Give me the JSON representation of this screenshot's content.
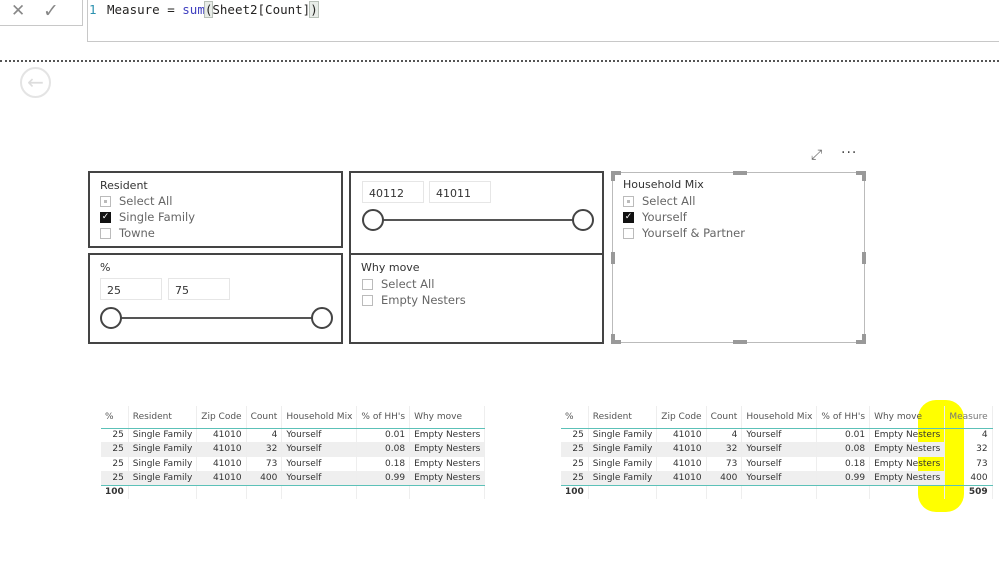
{
  "formula_bar": {
    "line_number": "1",
    "code_prefix": "Measure = ",
    "code_function": "sum",
    "code_open": "(",
    "code_arg": "Sheet2[Count]",
    "code_close": ")"
  },
  "icons": {
    "cancel": "✕",
    "commit": "✓",
    "back": "←",
    "focus": "⤢",
    "more": "···"
  },
  "slicers": {
    "resident": {
      "title": "Resident",
      "items": [
        {
          "label": "Select All",
          "state": "partial"
        },
        {
          "label": "Single Family",
          "state": "checked"
        },
        {
          "label": "Towne",
          "state": "unchecked"
        }
      ]
    },
    "percent": {
      "title": "%",
      "min": "25",
      "max": "75"
    },
    "zip": {
      "min": "40112",
      "max": "41011"
    },
    "why_move": {
      "title": "Why move",
      "items": [
        {
          "label": "Select All",
          "state": "unchecked"
        },
        {
          "label": "Empty Nesters",
          "state": "unchecked"
        }
      ]
    },
    "household_mix": {
      "title": "Household Mix",
      "items": [
        {
          "label": "Select All",
          "state": "partial"
        },
        {
          "label": "Yourself",
          "state": "checked"
        },
        {
          "label": "Yourself & Partner",
          "state": "unchecked"
        }
      ]
    }
  },
  "table_left": {
    "columns": [
      "%",
      "Resident",
      "Zip Code",
      "Count",
      "Household Mix",
      "% of HH's",
      "Why move"
    ],
    "rows": [
      [
        "25",
        "Single Family",
        "41010",
        "4",
        "Yourself",
        "0.01",
        "Empty Nesters"
      ],
      [
        "25",
        "Single Family",
        "41010",
        "32",
        "Yourself",
        "0.08",
        "Empty Nesters"
      ],
      [
        "25",
        "Single Family",
        "41010",
        "73",
        "Yourself",
        "0.18",
        "Empty Nesters"
      ],
      [
        "25",
        "Single Family",
        "41010",
        "400",
        "Yourself",
        "0.99",
        "Empty Nesters"
      ]
    ],
    "total": [
      "100",
      "",
      "",
      "",
      "",
      "",
      ""
    ]
  },
  "table_right": {
    "columns": [
      "%",
      "Resident",
      "Zip Code",
      "Count",
      "Household Mix",
      "% of HH's",
      "Why move",
      "Measure"
    ],
    "rows": [
      [
        "25",
        "Single Family",
        "41010",
        "4",
        "Yourself",
        "0.01",
        "Empty Nesters",
        "4"
      ],
      [
        "25",
        "Single Family",
        "41010",
        "32",
        "Yourself",
        "0.08",
        "Empty Nesters",
        "32"
      ],
      [
        "25",
        "Single Family",
        "41010",
        "73",
        "Yourself",
        "0.18",
        "Empty Nesters",
        "73"
      ],
      [
        "25",
        "Single Family",
        "41010",
        "400",
        "Yourself",
        "0.99",
        "Empty Nesters",
        "400"
      ]
    ],
    "total": [
      "100",
      "",
      "",
      "",
      "",
      "",
      "",
      "509"
    ]
  },
  "colors": {
    "highlight": "#ffff00",
    "accent_line": "#5cc1b8",
    "dax_function": "#4040c0"
  }
}
